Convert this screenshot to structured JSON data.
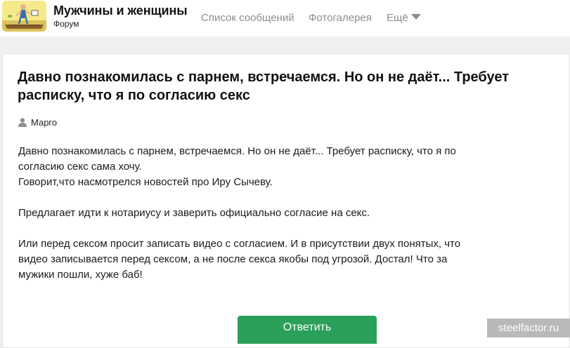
{
  "brand": {
    "title": "Мужчины и женщины",
    "subtitle": "Форум",
    "logo_icon": "forum-logo-icon"
  },
  "nav": {
    "items": [
      {
        "label": "Список сообщений"
      },
      {
        "label": "Фотогалерея"
      },
      {
        "label": "Ещё",
        "icon": "chevron-down-icon"
      }
    ]
  },
  "post": {
    "title": "Давно познакомилась с парнем, встречаемся. Но он не даёт... Требует расписку, что я по согласию секс",
    "author": "Марго",
    "author_icon": "user-icon",
    "paragraphs": [
      [
        "Давно познакомилась с парнем, встречаемся. Но он не даёт... Требует расписку, что я по",
        "согласию секс сама хочу.",
        "Говорит,что насмотрелся новостей про Иру Сычеву."
      ],
      [
        "Предлагает идти к нотариусу и заверить официально согласие на секс."
      ],
      [
        "Или перед сексом просит записать видео с согласием. И в присутствии двух понятых, что",
        "видео записывается перед сексом, а не после секса якобы под угрозой. Достал! Что за",
        "мужики пошли, хуже баб!"
      ]
    ]
  },
  "actions": {
    "reply_label": "Ответить"
  },
  "watermark": "steelfactor.ru",
  "colors": {
    "accent_green": "#2aa05a",
    "nav_gray": "#8b8e91",
    "page_bg": "#eef0f1"
  }
}
